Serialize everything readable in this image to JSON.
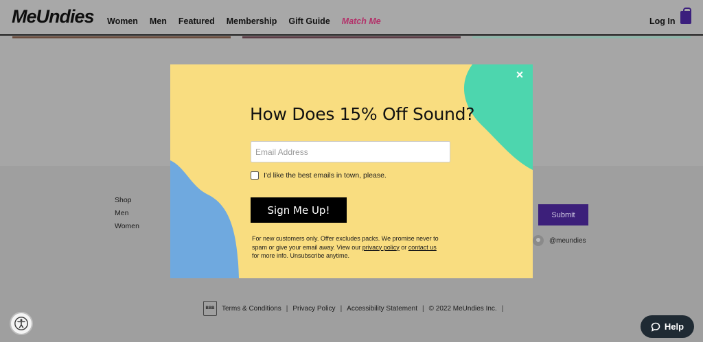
{
  "header": {
    "logo": "MeUndies",
    "nav": [
      "Women",
      "Men",
      "Featured",
      "Membership",
      "Gift Guide",
      "Match Me"
    ],
    "login": "Log In"
  },
  "footer": {
    "links": [
      "Shop",
      "Men",
      "Women"
    ],
    "submit": "Submit",
    "social_handle": "@meundies",
    "legal": [
      "Terms & Conditions",
      "Privacy Policy",
      "Accessibility Statement",
      "© 2022 MeUndies Inc."
    ],
    "bbb": "BBB"
  },
  "modal": {
    "close": "×",
    "title": "How Does 15% Off Sound?",
    "email_placeholder": "Email Address",
    "checkbox_label": "I'd like the best emails in town, please.",
    "button": "Sign Me Up!",
    "fine_print_1": "For new customers only. Offer excludes packs. We promise never to spam or give your email away. View our ",
    "privacy_link": "privacy policy",
    "fine_print_2": " or ",
    "contact_link": "contact us",
    "fine_print_3": " for more info. Unsubscribe anytime."
  },
  "widgets": {
    "help": "Help"
  },
  "colors": {
    "modal_bg": "#f9dd80",
    "blob_green": "#4dd6ae",
    "blob_blue": "#6fa9df",
    "submit_purple": "#3c1f7a",
    "match_me_pink": "#b3326a"
  }
}
